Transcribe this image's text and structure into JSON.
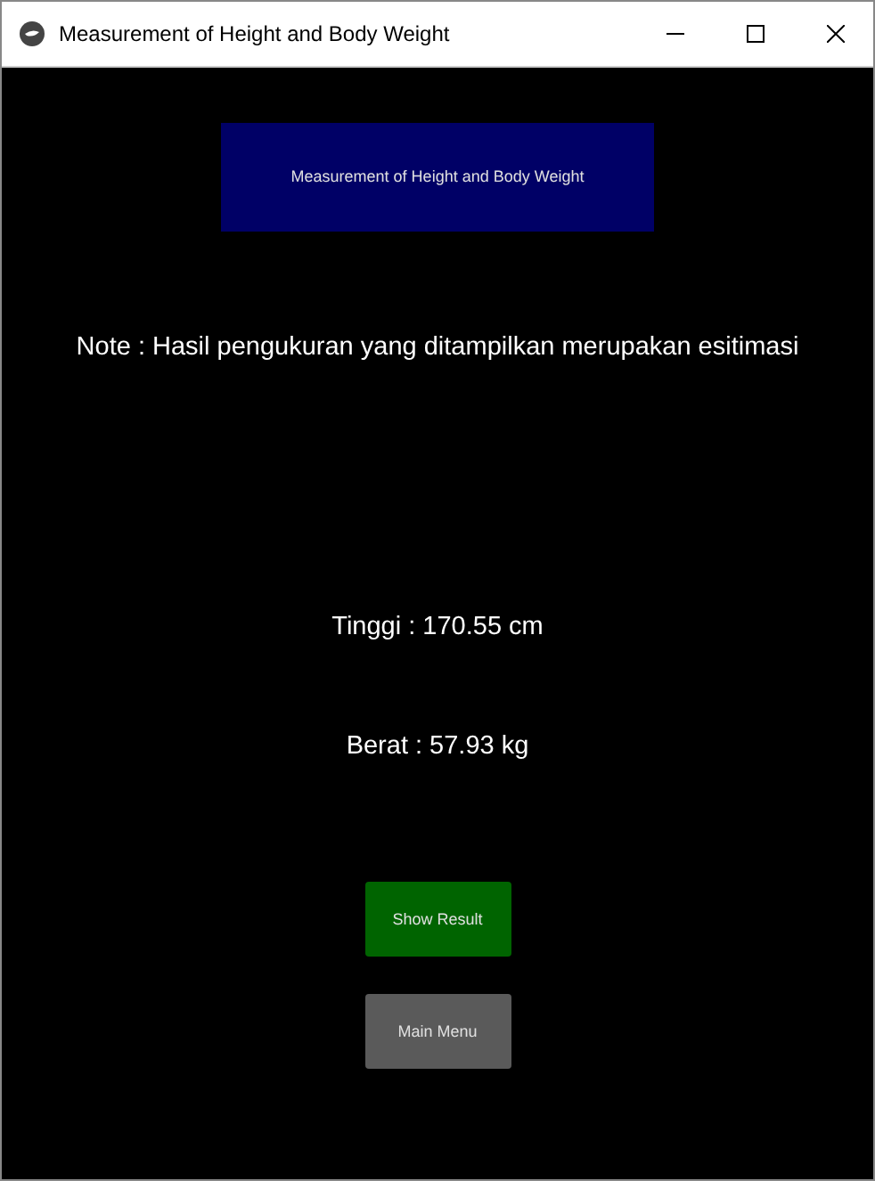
{
  "window": {
    "title": "Measurement of Height and Body Weight"
  },
  "banner": {
    "title": "Measurement of Height and Body Weight"
  },
  "note": "Note : Hasil pengukuran yang ditampilkan merupakan esitimasi",
  "readings": [
    "Tinggi : 170.55 cm",
    "Berat : 57.93 kg"
  ],
  "buttons": [
    {
      "label": "Show Result",
      "color": "#006400"
    },
    {
      "label": "Main Menu",
      "color": "#5a5a5a"
    }
  ]
}
